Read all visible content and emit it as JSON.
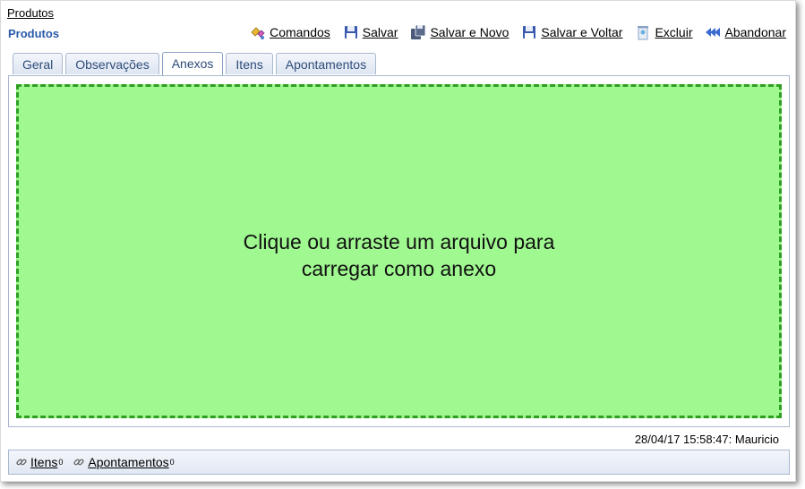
{
  "breadcrumb": "Produtos",
  "page_title": "Produtos",
  "toolbar": {
    "comandos": "Comandos",
    "salvar": "Salvar",
    "salvar_novo": "Salvar e Novo",
    "salvar_voltar": "Salvar e Voltar",
    "excluir": "Excluir",
    "abandonar": "Abandonar"
  },
  "tabs": [
    "Geral",
    "Observações",
    "Anexos",
    "Itens",
    "Apontamentos"
  ],
  "active_tab": "Anexos",
  "dropzone": {
    "line1": "Clique ou arraste um arquivo para",
    "line2": "carregar como anexo",
    "color": "#a0f890",
    "border_color": "#2f9f22"
  },
  "footer_info": "28/04/17 15:58:47: Mauricio",
  "bottom_links": [
    {
      "label": "Itens",
      "count": "0"
    },
    {
      "label": "Apontamentos",
      "count": "0"
    }
  ]
}
